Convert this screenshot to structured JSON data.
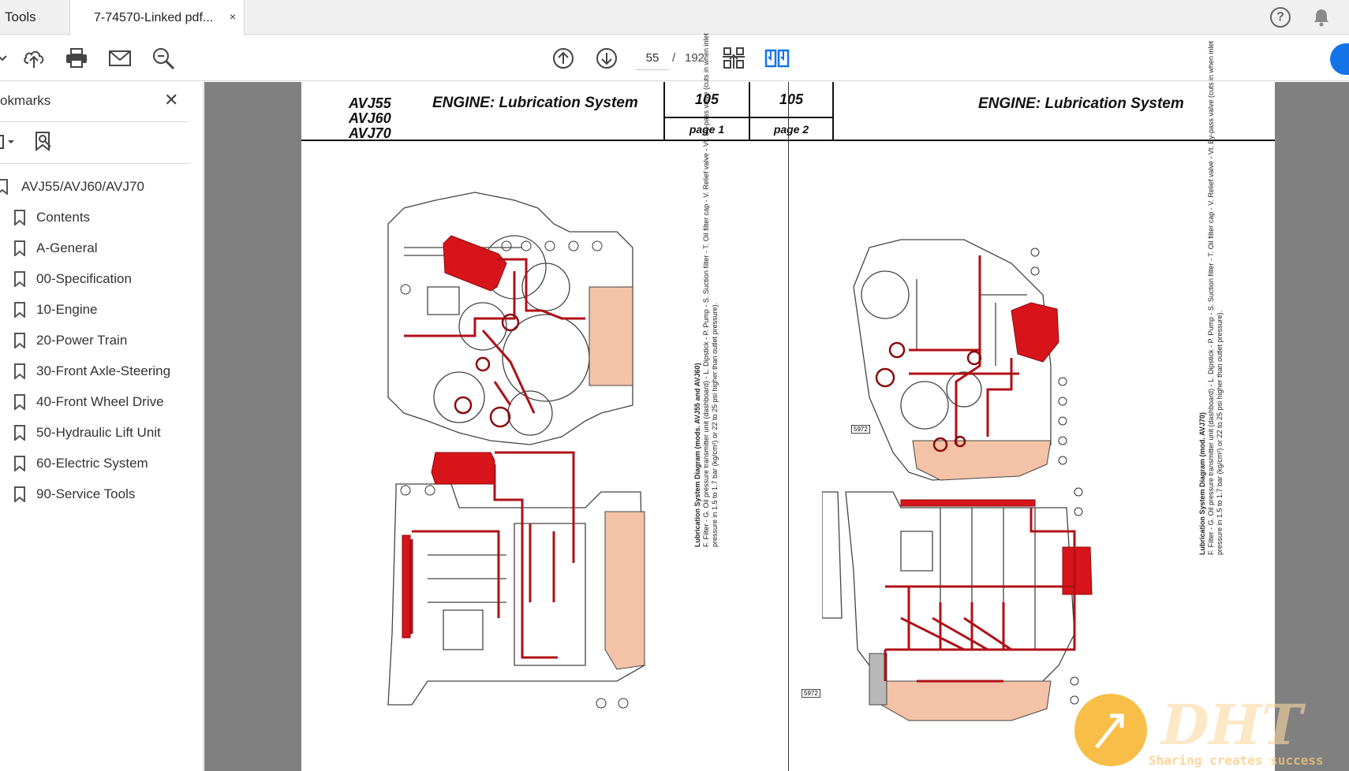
{
  "tabs": {
    "tools_label": "Tools",
    "document_label": "7-74570-Linked pdf...",
    "close_glyph": "×"
  },
  "toolbar": {
    "current_page": "55",
    "page_separator": "/",
    "total_pages": "192"
  },
  "top_right": {
    "help_glyph": "?"
  },
  "sidebar": {
    "title": "okmarks",
    "close_glyph": "✕",
    "items": [
      {
        "label": "AVJ55/AVJ60/AVJ70",
        "level": 0
      },
      {
        "label": "Contents",
        "level": 1
      },
      {
        "label": "A-General",
        "level": 1
      },
      {
        "label": "00-Specification",
        "level": 1
      },
      {
        "label": "10-Engine",
        "level": 1
      },
      {
        "label": "20-Power Train",
        "level": 1
      },
      {
        "label": "30-Front Axle-Steering",
        "level": 1
      },
      {
        "label": "40-Front Wheel Drive",
        "level": 1
      },
      {
        "label": "50-Hydraulic Lift Unit",
        "level": 1
      },
      {
        "label": "60-Electric System",
        "level": 1
      },
      {
        "label": "90-Service Tools",
        "level": 1
      }
    ]
  },
  "document": {
    "left_header": {
      "models": [
        "AVJ55",
        "AVJ60",
        "AVJ70"
      ],
      "title": "ENGINE: Lubrication System",
      "number": "105",
      "page_label": "page 1"
    },
    "right_header": {
      "title": "ENGINE: Lubrication System",
      "number": "105",
      "page_label": "page 2"
    },
    "left_caption_lines": [
      "Lubrication System Diagram (mods. AVJ55 and AVJ60)",
      "F. Filter - G. Oil pressure transmitter unit (dashboard) - L. Dipstick - P. Pump - S. Suction filter - T. Oil filter cap - V. Relief valve - Vt. By-pass valve (cuts in when inlet",
      "pressure in 1.5 to 1.7 bar (kg/cm²) or 22 to 25 psi higher than outlet pressure)."
    ],
    "right_caption_lines": [
      "Lubrication System Diagram (mod. AVJ70)",
      "F. Filter - G. Oil pressure transmitter unit (dashboard) - L. Dipstick - P. Pump - S. Suction filter - T. Oil filter cap - V. Relief valve - Vt. By-pass valve (cuts in when inlet",
      "pressure in 1.5 to 1.7 bar (kg/cm²) or 22 to 25 psi higher than outlet pressure)."
    ],
    "figure_codes": [
      "5972",
      "5972"
    ]
  },
  "watermark": {
    "slogan": "Sharing creates success"
  },
  "colors": {
    "accent_blue": "#1473e6",
    "oil_red": "#d8141b",
    "oil_sump": "#f4c2a6"
  }
}
